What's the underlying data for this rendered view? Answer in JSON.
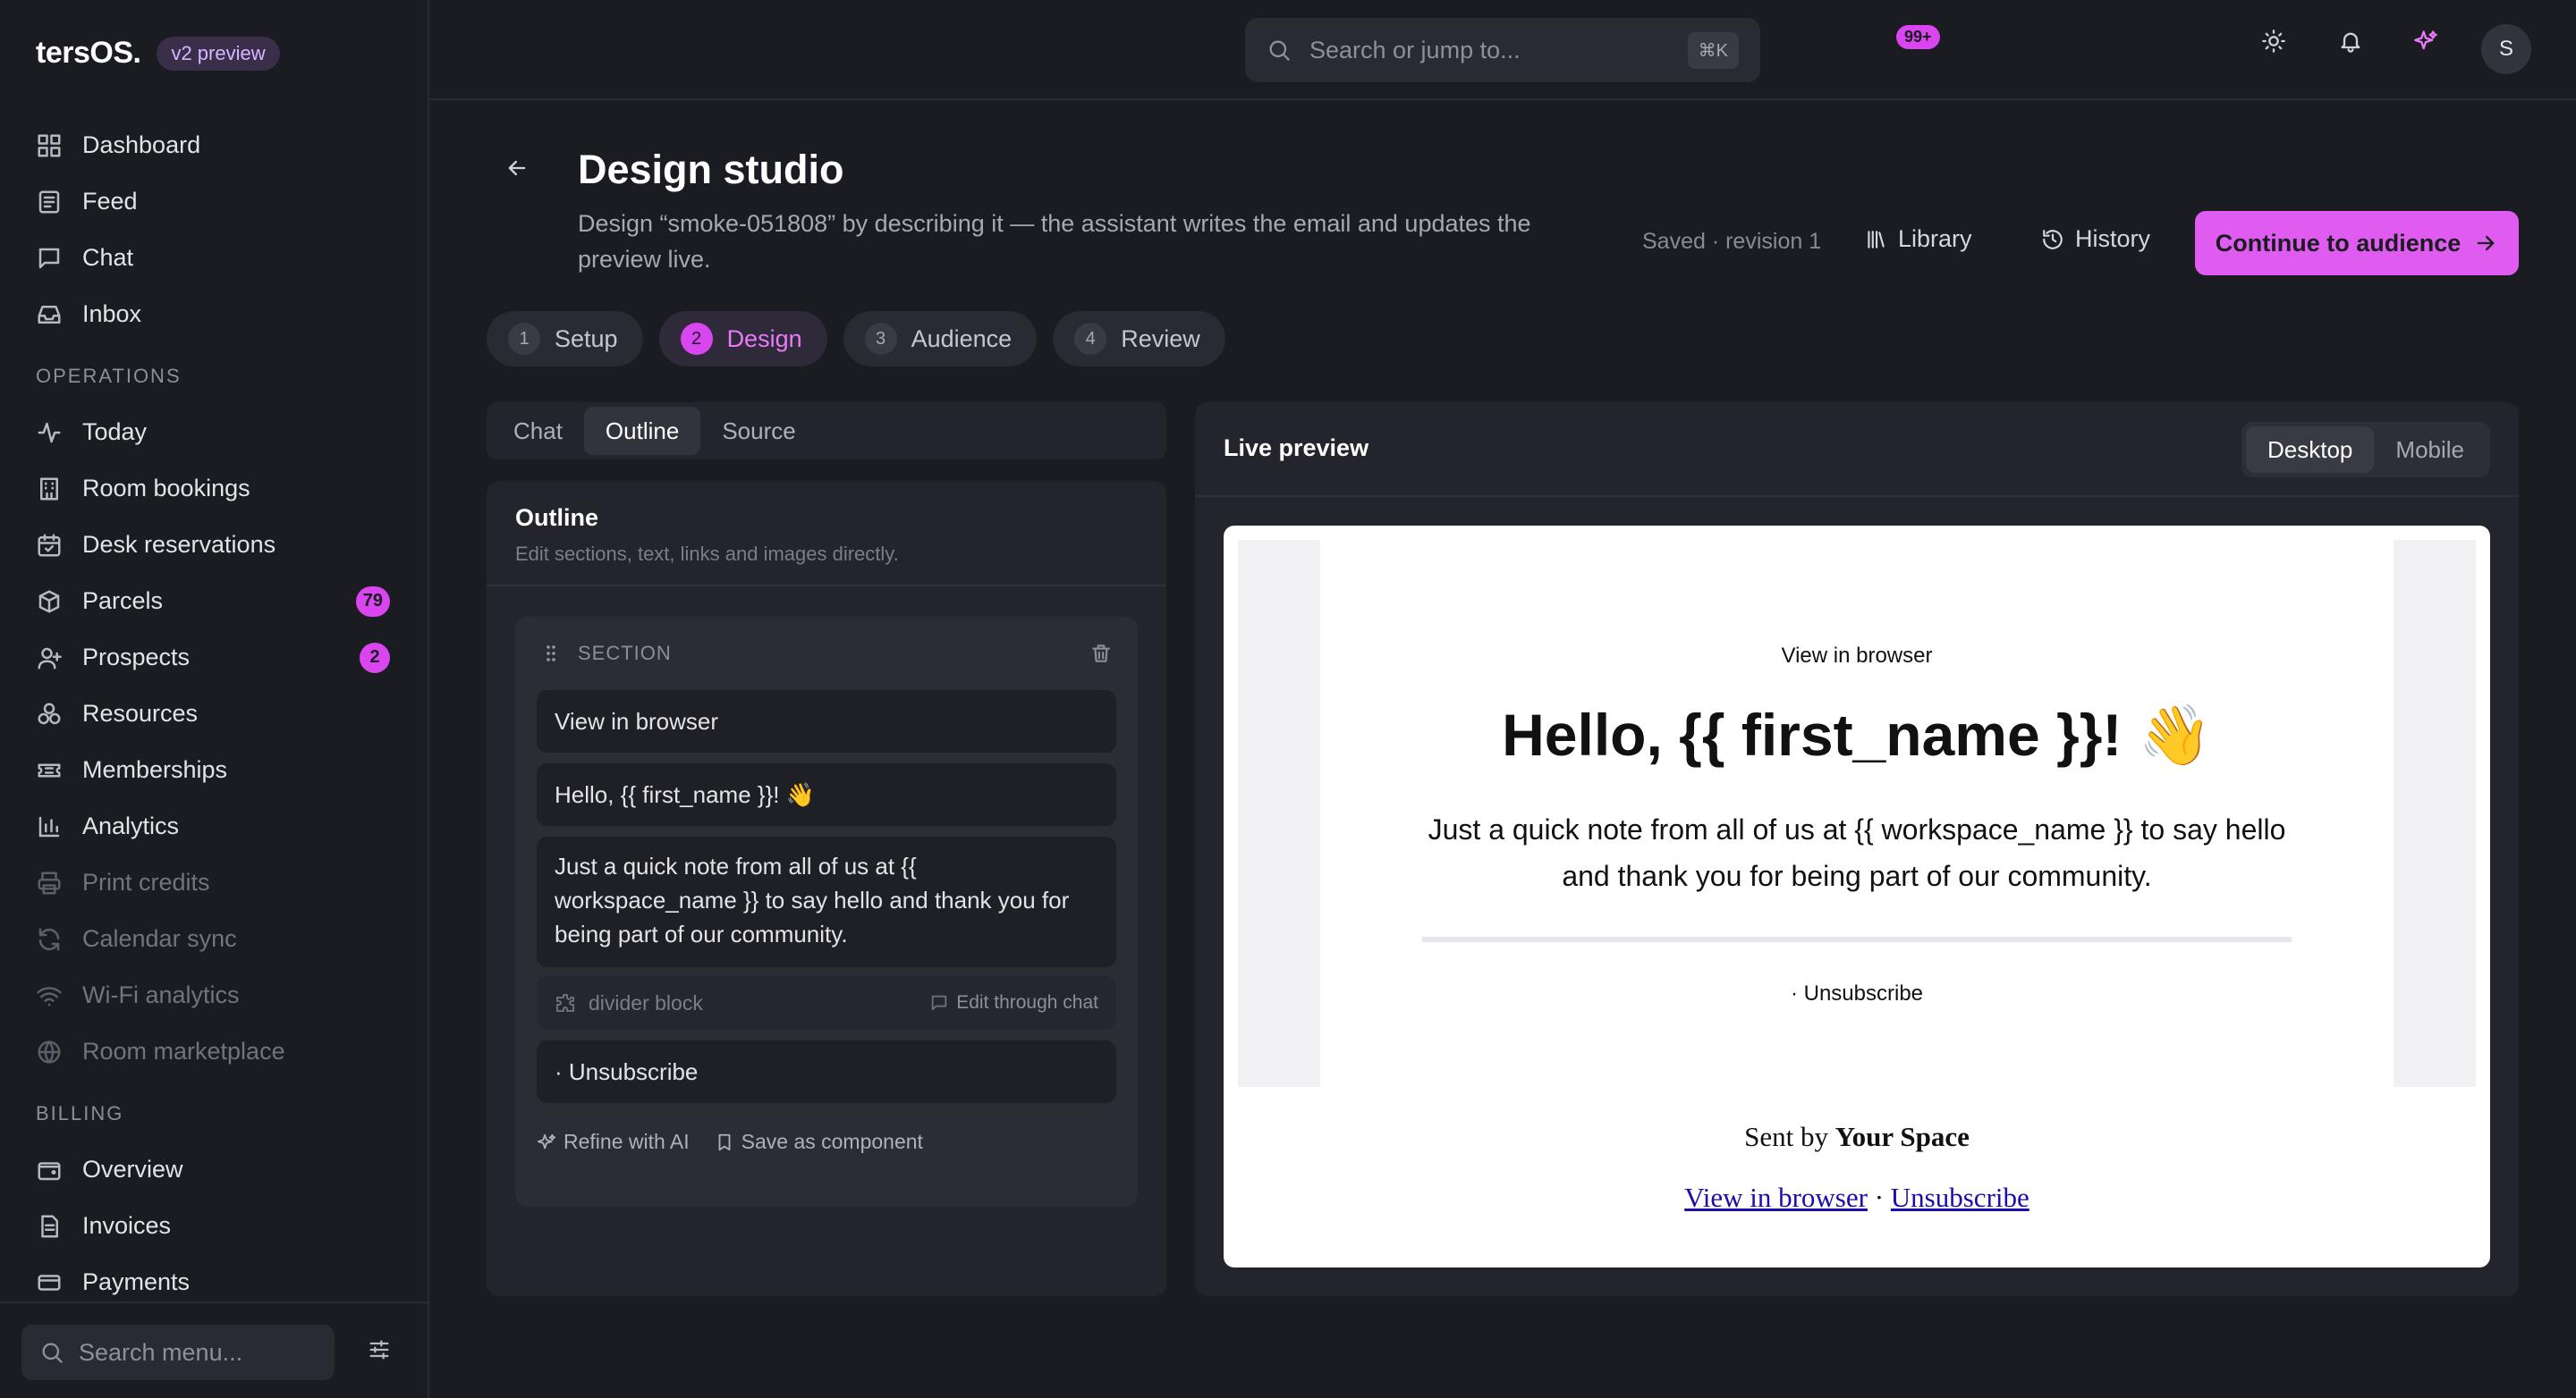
{
  "brand": {
    "name": "tersOS.",
    "badge": "v2 preview"
  },
  "sidebar": {
    "items": [
      {
        "label": "Dashboard",
        "icon": "grid-icon"
      },
      {
        "label": "Feed",
        "icon": "newspaper-icon"
      },
      {
        "label": "Chat",
        "icon": "chat-icon"
      },
      {
        "label": "Inbox",
        "icon": "inbox-icon"
      }
    ],
    "operations_label": "OPERATIONS",
    "operations": [
      {
        "label": "Today",
        "icon": "activity-icon"
      },
      {
        "label": "Room bookings",
        "icon": "building-icon"
      },
      {
        "label": "Desk reservations",
        "icon": "calendar-check-icon"
      },
      {
        "label": "Parcels",
        "icon": "package-icon",
        "count": "79"
      },
      {
        "label": "Prospects",
        "icon": "user-plus-icon",
        "count": "2"
      },
      {
        "label": "Resources",
        "icon": "resources-icon"
      },
      {
        "label": "Memberships",
        "icon": "ticket-icon"
      },
      {
        "label": "Analytics",
        "icon": "bar-chart-icon"
      },
      {
        "label": "Print credits",
        "icon": "printer-icon",
        "dim": true
      },
      {
        "label": "Calendar sync",
        "icon": "refresh-icon",
        "dim": true
      },
      {
        "label": "Wi-Fi analytics",
        "icon": "wifi-icon",
        "dim": true
      },
      {
        "label": "Room marketplace",
        "icon": "globe-icon",
        "dim": true
      }
    ],
    "billing_label": "BILLING",
    "billing": [
      {
        "label": "Overview",
        "icon": "wallet-icon"
      },
      {
        "label": "Invoices",
        "icon": "invoice-icon"
      },
      {
        "label": "Payments",
        "icon": "card-icon"
      }
    ],
    "search_placeholder": "Search menu..."
  },
  "topbar": {
    "search_placeholder": "Search or jump to...",
    "shortcut": "⌘K",
    "notifications": "99+",
    "avatar": "S"
  },
  "header": {
    "title": "Design studio",
    "subtitle": "Design “smoke-051808” by describing it — the assistant writes the email and updates the preview live.",
    "saved": "Saved · revision 1",
    "library": "Library",
    "history": "History",
    "cta": "Continue to audience"
  },
  "steps": [
    {
      "num": "1",
      "label": "Setup"
    },
    {
      "num": "2",
      "label": "Design",
      "active": true
    },
    {
      "num": "3",
      "label": "Audience"
    },
    {
      "num": "4",
      "label": "Review"
    }
  ],
  "left_tabs": [
    "Chat",
    "Outline",
    "Source"
  ],
  "left_tab_active": "Outline",
  "outline": {
    "title": "Outline",
    "desc": "Edit sections, text, links and images directly.",
    "section_label": "SECTION",
    "blocks": {
      "view": "View in browser",
      "hello": "Hello, {{ first_name }}! 👋",
      "note": "Just a quick note from all of us at {{ workspace_name }} to say hello and thank you for being part of our community.",
      "divider": "divider block",
      "divider_edit": "Edit through chat",
      "unsub": "· Unsubscribe"
    },
    "refine": "Refine with AI",
    "save_component": "Save as component"
  },
  "preview": {
    "title": "Live preview",
    "devices": [
      "Desktop",
      "Mobile"
    ],
    "device_active": "Desktop",
    "email": {
      "view": "View in browser",
      "hello": "Hello, {{ first_name }}! 👋",
      "note": "Just a quick note from all of us at {{ workspace_name }} to say hello and thank you for being part of our community.",
      "unsub": "· Unsubscribe",
      "sent_prefix": "Sent by",
      "sent_name": "Your Space",
      "link_view": "View in browser",
      "link_sep": "·",
      "link_unsub": "Unsubscribe"
    }
  }
}
